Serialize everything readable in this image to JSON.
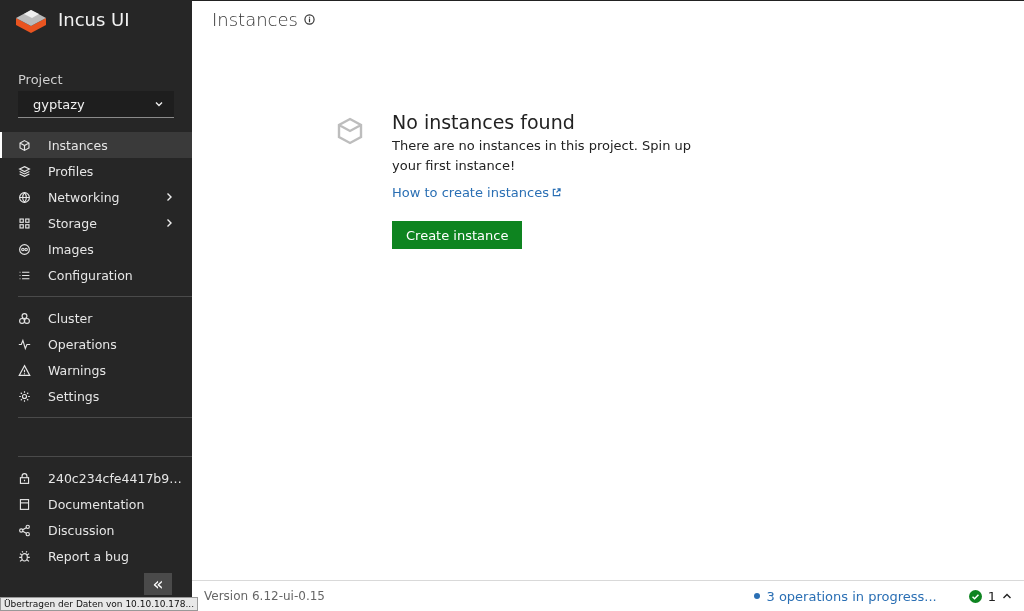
{
  "app": {
    "name": "Incus UI"
  },
  "project": {
    "label": "Project",
    "value": "gyptazy"
  },
  "nav_groups": [
    [
      {
        "label": "Instances",
        "selected": true,
        "expandable": false
      },
      {
        "label": "Profiles",
        "selected": false,
        "expandable": false
      },
      {
        "label": "Networking",
        "selected": false,
        "expandable": true
      },
      {
        "label": "Storage",
        "selected": false,
        "expandable": true
      },
      {
        "label": "Images",
        "selected": false,
        "expandable": false
      },
      {
        "label": "Configuration",
        "selected": false,
        "expandable": false
      }
    ],
    [
      {
        "label": "Cluster",
        "selected": false,
        "expandable": false
      },
      {
        "label": "Operations",
        "selected": false,
        "expandable": false
      },
      {
        "label": "Warnings",
        "selected": false,
        "expandable": false
      },
      {
        "label": "Settings",
        "selected": false,
        "expandable": false
      }
    ],
    [
      {
        "label": "240c234cfe4417b9…",
        "selected": false,
        "expandable": false
      },
      {
        "label": "Documentation",
        "selected": false,
        "expandable": false
      },
      {
        "label": "Discussion",
        "selected": false,
        "expandable": false
      },
      {
        "label": "Report a bug",
        "selected": false,
        "expandable": false
      }
    ]
  ],
  "collapse_button": {
    "label": "«"
  },
  "page": {
    "title": "Instances"
  },
  "empty_state": {
    "title": "No instances found",
    "text": "There are no instances in this project. Spin up your first instance!",
    "link": "How to create instances",
    "button": "Create instance"
  },
  "status_bar": {
    "version": "Version 6.12-ui-0.15",
    "operations": "3 operations in progress...",
    "count": "1"
  },
  "browser_status": {
    "text": "Übertragen der Daten von 10.10.10.178..."
  }
}
